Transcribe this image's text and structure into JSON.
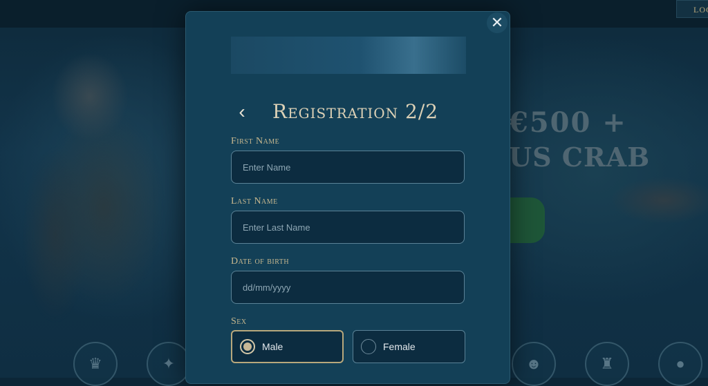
{
  "header": {
    "login_label": "LOGIN"
  },
  "promo": {
    "line1": "€500 +",
    "line2": "US CRAB"
  },
  "modal": {
    "title": "Registration 2/2",
    "close_icon": "close-icon",
    "back_icon": "chevron-left-icon",
    "fields": {
      "first_name": {
        "label": "First Name",
        "placeholder": "Enter Name"
      },
      "last_name": {
        "label": "Last Name",
        "placeholder": "Enter Last Name"
      },
      "dob": {
        "label": "Date of birth",
        "placeholder": "dd/mm/yyyy"
      }
    },
    "sex": {
      "label": "Sex",
      "options": [
        {
          "label": "Male",
          "selected": true
        },
        {
          "label": "Female",
          "selected": false
        }
      ]
    }
  },
  "colors": {
    "modal_bg": "#134057",
    "accent_gold": "#c8b88f",
    "field_bg": "#0c2c40"
  }
}
